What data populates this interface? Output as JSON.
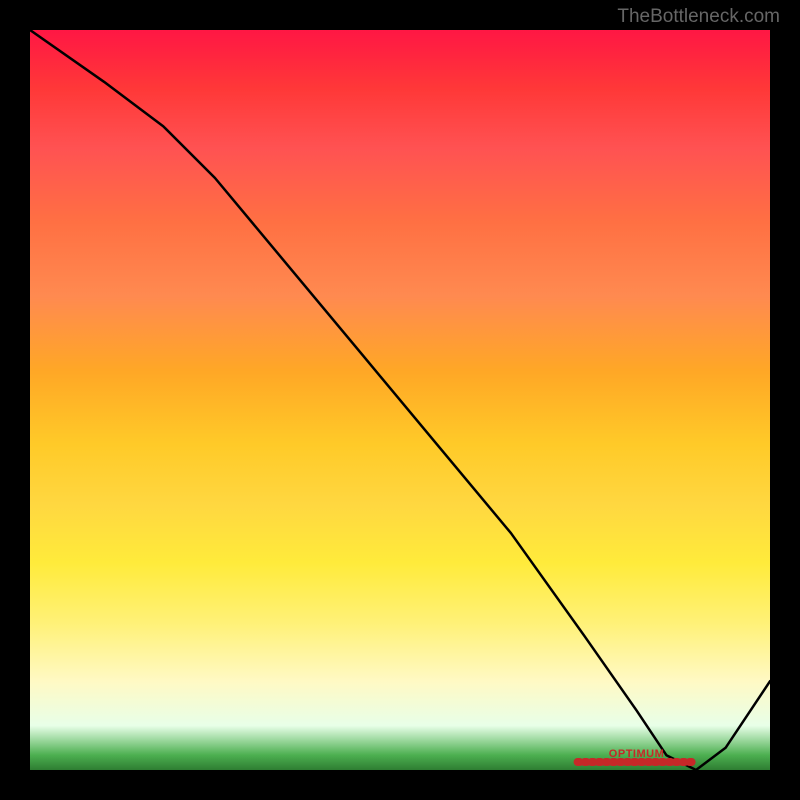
{
  "credit": "TheBottleneck.com",
  "optimum_label": "OPTIMUM",
  "chart_data": {
    "type": "line",
    "title": "",
    "xlabel": "",
    "ylabel": "",
    "xlim": [
      0,
      100
    ],
    "ylim": [
      0,
      100
    ],
    "series": [
      {
        "name": "curve",
        "x": [
          0,
          10,
          18,
          25,
          35,
          45,
          55,
          65,
          75,
          82,
          86,
          90,
          94,
          100
        ],
        "values": [
          100,
          93,
          87,
          80,
          68,
          56,
          44,
          32,
          18,
          8,
          2,
          0,
          3,
          12
        ]
      }
    ],
    "optimum_range": [
      74,
      90
    ],
    "gradient_stops": [
      {
        "pos": 0.0,
        "color": "#ff1744"
      },
      {
        "pos": 0.2,
        "color": "#ff5252"
      },
      {
        "pos": 0.4,
        "color": "#ff8a50"
      },
      {
        "pos": 0.55,
        "color": "#ffca28"
      },
      {
        "pos": 0.7,
        "color": "#ffeb3b"
      },
      {
        "pos": 0.85,
        "color": "#fff9c4"
      },
      {
        "pos": 0.95,
        "color": "#a5d6a7"
      },
      {
        "pos": 1.0,
        "color": "#2e7d32"
      }
    ]
  }
}
